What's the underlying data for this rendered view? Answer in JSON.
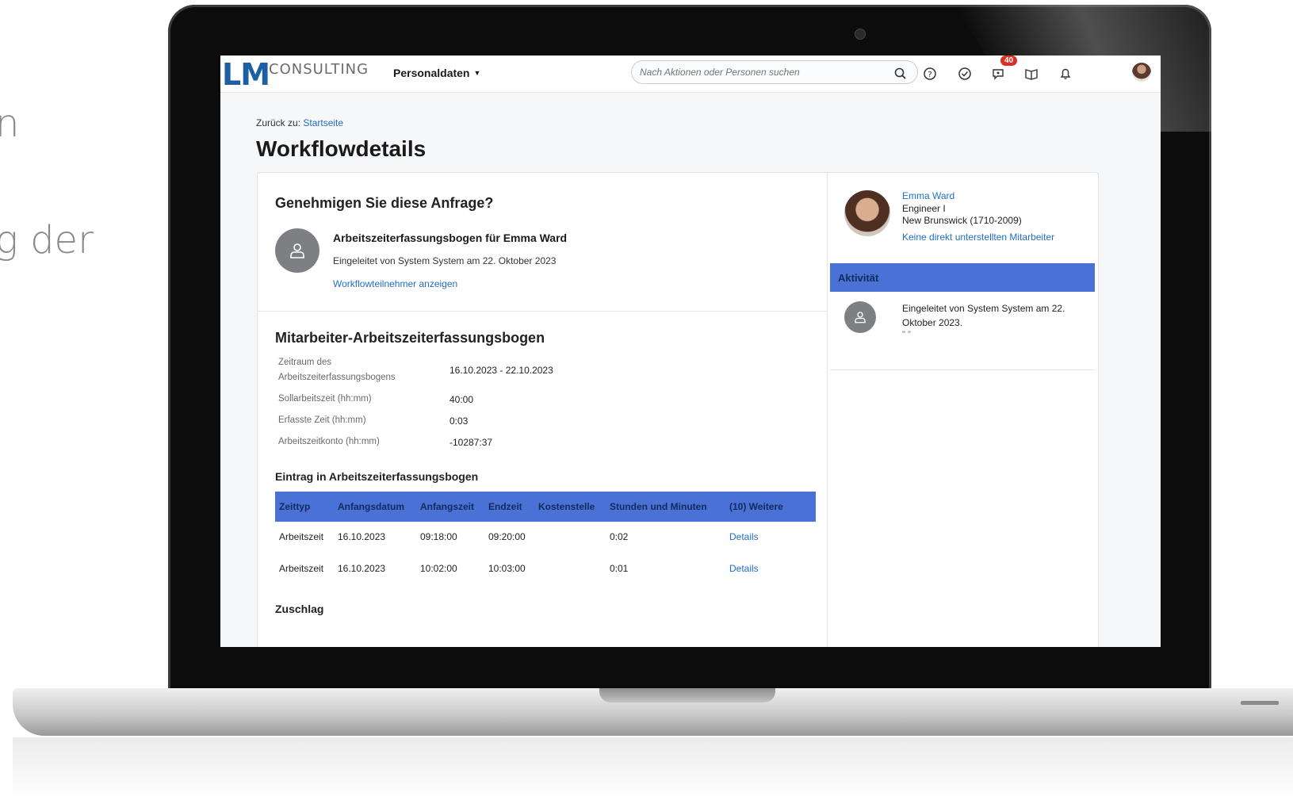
{
  "background": {
    "line1": "n",
    "line2": "g der"
  },
  "header": {
    "logo_lm": "LM",
    "logo_consulting": "CONSULTING",
    "menu_label": "Personaldaten",
    "search_placeholder": "Nach Aktionen oder Personen suchen",
    "badge_count": "40",
    "icons": [
      "search-icon",
      "help-icon",
      "todo-icon",
      "feedback-icon",
      "book-icon",
      "bell-icon",
      "user-avatar"
    ]
  },
  "breadcrumb": {
    "prefix": "Zurück zu:",
    "link": "Startseite"
  },
  "page_title": "Workflowdetails",
  "request": {
    "question": "Genehmigen Sie diese Anfrage?",
    "title": "Arbeitszeiterfassungsbogen für Emma Ward",
    "subtitle": "Eingeleitet von System System am 22. Oktober 2023",
    "participants_link": "Workflowteilnehmer anzeigen"
  },
  "timesheet": {
    "section_title": "Mitarbeiter-Arbeitszeiterfassungsbogen",
    "fields": [
      {
        "label": "Zeitraum des Arbeitszeiterfassungsbogens",
        "value": "16.10.2023 - 22.10.2023"
      },
      {
        "label": "Sollarbeitszeit (hh:mm)",
        "value": "40:00"
      },
      {
        "label": "Erfasste Zeit (hh:mm)",
        "value": "0:03"
      },
      {
        "label": "Arbeitszeitkonto (hh:mm)",
        "value": "-10287:37"
      }
    ],
    "entries_title": "Eintrag in Arbeitszeiterfassungsbogen",
    "columns": [
      "Zeittyp",
      "Anfangsdatum",
      "Anfangszeit",
      "Endzeit",
      "Kostenstelle",
      "Stunden und Minuten",
      "(10) Weitere"
    ],
    "rows": [
      [
        "Arbeitszeit",
        "16.10.2023",
        "09:18:00",
        "09:20:00",
        "",
        "0:02",
        "Details"
      ],
      [
        "Arbeitszeit",
        "16.10.2023",
        "10:02:00",
        "10:03:00",
        "",
        "0:01",
        "Details"
      ]
    ],
    "surcharge_title": "Zuschlag"
  },
  "employee": {
    "name": "Emma Ward",
    "role": "Engineer I",
    "location": "New Brunswick (1710-2009)",
    "reports_link": "Keine direkt unterstellten Mitarbeiter"
  },
  "activity": {
    "label": "Aktivität",
    "text": "Eingeleitet von System System am 22. Oktober 2023.",
    "quote": "\" \""
  },
  "colors": {
    "accent_blue": "#4a72d6",
    "link_blue": "#1f6fc5",
    "badge_red": "#d93025",
    "logo_blue": "#1c5fa3"
  }
}
